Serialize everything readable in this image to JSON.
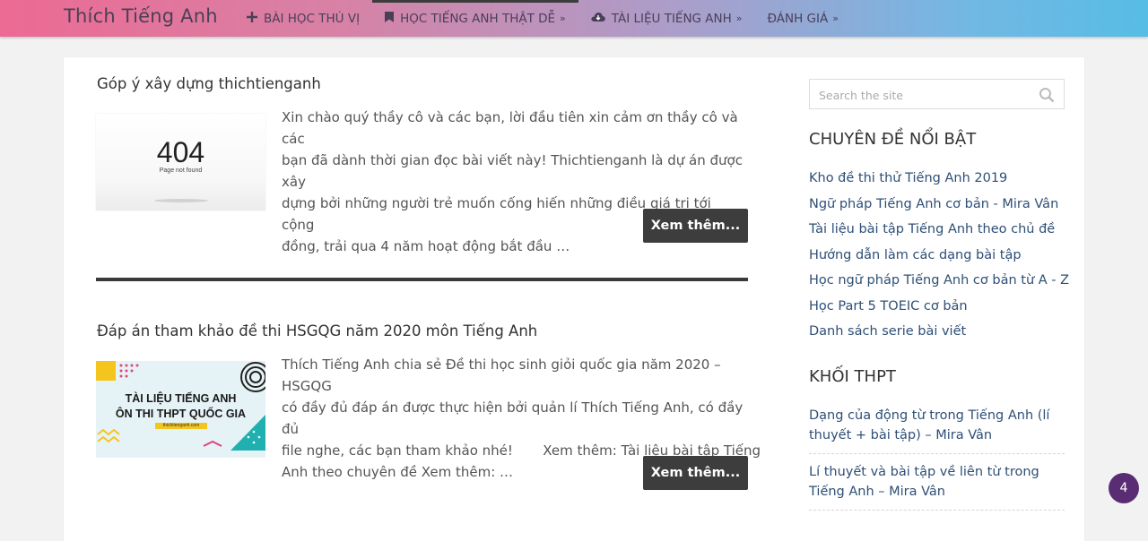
{
  "header": {
    "logo": "Thích Tiếng Anh",
    "nav": [
      {
        "label": "BÀI HỌC THÚ VỊ",
        "icon": "plus-icon",
        "chevron": false
      },
      {
        "label": "HỌC TIẾNG ANH THẬT DỄ",
        "icon": "bookmark-icon",
        "chevron": true
      },
      {
        "label": "TÀI LIỆU TIẾNG ANH",
        "icon": "cloud-download-icon",
        "chevron": true
      },
      {
        "label": "ĐÁNH GIÁ",
        "icon": "",
        "chevron": true
      }
    ]
  },
  "posts": [
    {
      "title": "Góp ý xây dựng thichtienganh",
      "thumb_text": {
        "code": "404",
        "caption": "Page not found"
      },
      "excerpt": [
        "Xin chào quý thầy cô và các bạn, lời đầu tiên xin cảm ơn thầy cô và các",
        "bạn đã dành thời gian đọc bài viết này! Thichtienganh là dự án được xây",
        "dựng bởi những người trẻ muốn cống hiến những điều giá trị tới cộng",
        "đồng, trải qua 4 năm hoạt động bắt đầu …"
      ],
      "more_label": "Xem thêm..."
    },
    {
      "title": "Đáp án tham khảo đề thi HSGQG năm 2020 môn Tiếng Anh",
      "thumb_text": {
        "line1": "TÀI LIỆU TIẾNG ANH",
        "line2": "ÔN THI THPT QUỐC GIA",
        "site": "thichtienganh.com"
      },
      "excerpt": [
        "Thích Tiếng Anh chia sẻ Đề thi học sinh giỏi quốc gia năm 2020 – HSGQG",
        "có đầy đủ đáp án được thực hiện bởi quản lí Thích Tiếng Anh, có đầy đủ",
        "file nghe, các bạn tham khảo nhé!       Xem thêm: Tài liệu bài tập Tiếng",
        "Anh theo chuyên đề Xem thêm: …"
      ],
      "more_label": "Xem thêm..."
    }
  ],
  "sidebar": {
    "search_placeholder": "Search the site",
    "featured_title": "CHUYÊN ĐỀ NỔI BẬT",
    "featured": [
      "Kho đề thi thử Tiếng Anh 2019",
      "Ngữ pháp Tiếng Anh cơ bản - Mira Vân",
      "Tài liệu bài tập Tiếng Anh theo chủ đề",
      "Hướng dẫn làm các dạng bài tập",
      "Học ngữ pháp Tiếng Anh cơ bản từ A - Z",
      "Học Part 5 TOEIC cơ bản",
      "Danh sách serie bài viết"
    ],
    "thpt_title": "KHỐI THPT",
    "thpt": [
      "Dạng của động từ trong Tiếng Anh (lí thuyết + bài tập) – Mira Vân",
      "Lí thuyết và bài tập về liên từ trong Tiếng Anh – Mira Vân"
    ]
  },
  "badge": "4",
  "colors": {
    "accent_dark": "#3d3d3d",
    "link": "#2e4f76",
    "badge": "#5a2c74"
  }
}
